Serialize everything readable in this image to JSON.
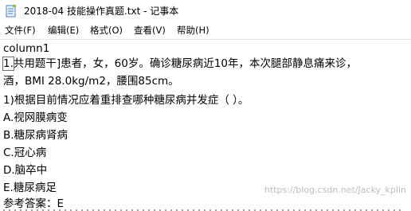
{
  "window": {
    "title": "2018-04 技能操作真题.txt - 记事本",
    "icon": "notepad-icon"
  },
  "menu": {
    "items": [
      {
        "label": "文件(F)"
      },
      {
        "label": "编辑(E)"
      },
      {
        "label": "格式(O)"
      },
      {
        "label": "查看(V)"
      },
      {
        "label": "帮助(H)"
      }
    ]
  },
  "document": {
    "lines": [
      "column1",
      "1.共用题干]患者，女，60岁。确诊糖尿病近10年，本次腿部静息痛来诊，",
      "酒，BMI 28.0kg/m2，腰围85cm。",
      "1)根据目前情况应着重排查哪种糖尿病并发症（ ）。",
      "A.视网膜病变",
      "B.糖尿病肾病",
      "C.冠心病",
      "D.脑卒中",
      "E.糖尿病足",
      "参考答案：E"
    ]
  },
  "watermark": {
    "text": "https://blog.csdn.net/Jacky_kplin"
  }
}
